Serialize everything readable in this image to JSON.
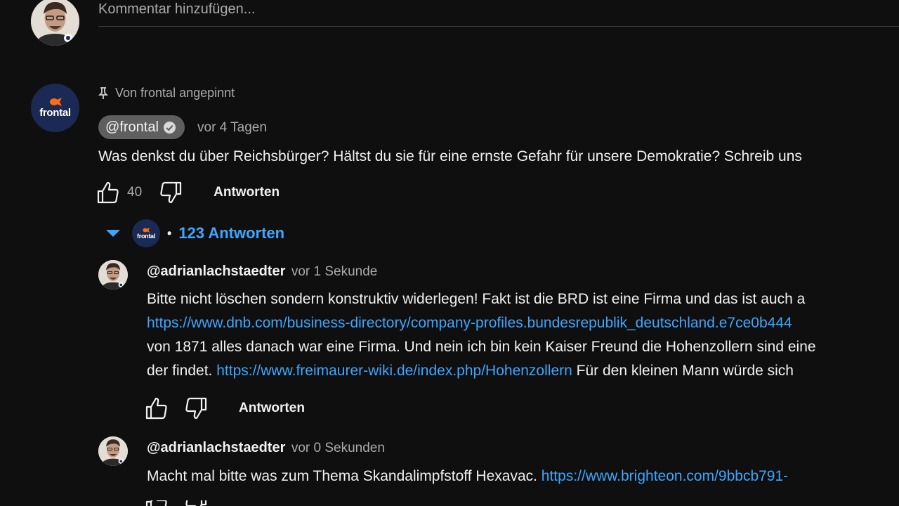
{
  "add_comment": {
    "placeholder": "Kommentar hinzufügen..."
  },
  "pinned_comment": {
    "pinned_label": "Von frontal angepinnt",
    "author": "@frontal",
    "timestamp": "vor 4 Tagen",
    "avatar_text": "frontal",
    "text": "Was denkst du über Reichsbürger? Hältst du sie für eine ernste Gefahr für unsere Demokratie? Schreib uns",
    "likes": "40",
    "reply_label": "Antworten",
    "replies_count_label": "123 Antworten",
    "replies_dot": "•"
  },
  "replies": [
    {
      "author": "@adrianlachstaedter",
      "timestamp": "vor 1 Sekunde",
      "lines": [
        {
          "text": "Bitte nicht löschen sondern konstruktiv widerlegen! Fakt ist die BRD ist eine Firma und das ist auch a"
        },
        {
          "link": "https://www.dnb.com/business-directory/company-profiles.bundesrepublik_deutschland.e7ce0b444"
        },
        {
          "text": "von 1871 alles danach war eine Firma. Und nein ich bin kein Kaiser Freund die Hohenzollern sind eine"
        },
        {
          "text": "der findet. ",
          "link": "https://www.freimaurer-wiki.de/index.php/Hohenzollern",
          "tail": " Für den kleinen Mann würde sich"
        }
      ],
      "reply_label": "Antworten"
    },
    {
      "author": "@adrianlachstaedter",
      "timestamp": "vor 0 Sekunden",
      "lines": [
        {
          "text": "Macht mal bitte was zum Thema Skandalimpfstoff Hexavac. ",
          "link": "https://www.brighteon.com/9bbcb791-"
        }
      ]
    }
  ],
  "colors": {
    "background": "#0f0f0f",
    "text": "#f1f1f1",
    "muted": "#aaaaaa",
    "link": "#3ea6ff",
    "chip": "#5f5f5f",
    "frontal_avatar": "#1b2a55",
    "frontal_accent": "#ff6a13"
  }
}
